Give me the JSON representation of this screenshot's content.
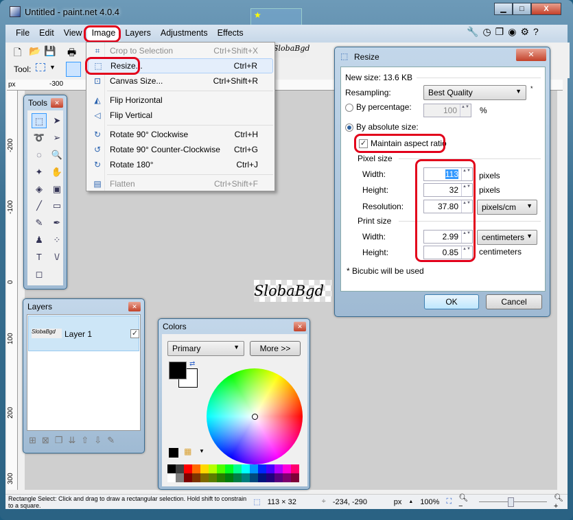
{
  "window": {
    "title": "Untitled - paint.net 4.0.4",
    "minimize": "▁",
    "maximize": "□",
    "close": "X"
  },
  "menubar": [
    "File",
    "Edit",
    "View",
    "Image",
    "Layers",
    "Adjustments",
    "Effects"
  ],
  "toolbar": {
    "tool_label": "Tool:"
  },
  "rulers": {
    "unit": "px",
    "top": [
      "-300"
    ],
    "left": [
      "-200",
      "-100",
      "0",
      "100",
      "200",
      "300"
    ]
  },
  "image_menu": {
    "items": [
      {
        "label": "Crop to Selection",
        "shortcut": "Ctrl+Shift+X",
        "icon": "crop-icon",
        "disabled": true
      },
      {
        "label": "Resize...",
        "shortcut": "Ctrl+R",
        "icon": "resize-icon",
        "highlighted": true
      },
      {
        "label": "Canvas Size...",
        "shortcut": "Ctrl+Shift+R",
        "icon": "canvas-size-icon"
      },
      {
        "label": "Flip Horizontal",
        "shortcut": "",
        "icon": "flip-horizontal-icon"
      },
      {
        "label": "Flip Vertical",
        "shortcut": "",
        "icon": "flip-vertical-icon"
      },
      {
        "label": "Rotate 90° Clockwise",
        "shortcut": "Ctrl+H",
        "icon": "rotate-cw-icon"
      },
      {
        "label": "Rotate 90° Counter-Clockwise",
        "shortcut": "Ctrl+G",
        "icon": "rotate-ccw-icon"
      },
      {
        "label": "Rotate 180°",
        "shortcut": "Ctrl+J",
        "icon": "rotate-180-icon"
      },
      {
        "label": "Flatten",
        "shortcut": "Ctrl+Shift+F",
        "icon": "flatten-icon",
        "disabled": true
      }
    ]
  },
  "tools_panel": {
    "title": "Tools"
  },
  "layers_panel": {
    "title": "Layers",
    "layer_name": "Layer 1",
    "thumb_text": "SlobaBgd"
  },
  "colors_panel": {
    "title": "Colors",
    "mode": "Primary",
    "more_button": "More >>"
  },
  "canvas": {
    "image_text": "SlobaBgd"
  },
  "resize_dialog": {
    "title": "Resize",
    "new_size": "New size: 13.6 KB",
    "resampling_label": "Resampling:",
    "resampling_value": "Best Quality",
    "asterisk": "*",
    "by_percentage_label": "By percentage:",
    "percentage_value": "100",
    "percent_sign": "%",
    "by_absolute_label": "By absolute size:",
    "maintain_label": "Maintain aspect ratio",
    "pixel_size_label": "Pixel size",
    "width_label": "Width:",
    "width_value": "113",
    "height_label": "Height:",
    "height_value": "32",
    "pixels_unit": "pixels",
    "resolution_label": "Resolution:",
    "resolution_value": "37.80",
    "resolution_unit": "pixels/cm",
    "print_size_label": "Print size",
    "print_width_value": "2.99",
    "print_height_value": "0.85",
    "print_unit": "centimeters",
    "note": "* Bicubic will be used",
    "ok": "OK",
    "cancel": "Cancel"
  },
  "statusbar": {
    "hint": "Rectangle Select: Click and drag to draw a rectangular selection. Hold shift to constrain to a square.",
    "selection_size": "113 × 32",
    "cursor": "-234, -290",
    "unit": "px",
    "zoom": "100%"
  },
  "palette": [
    "#000000",
    "#404040",
    "#ff0000",
    "#ff6a00",
    "#ffd800",
    "#b6ff00",
    "#4cff00",
    "#00ff21",
    "#00ff90",
    "#00ffff",
    "#0094ff",
    "#0026ff",
    "#4800ff",
    "#b200ff",
    "#ff00dc",
    "#ff006e",
    "#ffffff",
    "#808080",
    "#7f0000",
    "#7f3300",
    "#7f6a00",
    "#5b7f00",
    "#267f00",
    "#007f0e",
    "#007f46",
    "#007f7f",
    "#004a7f",
    "#00137f",
    "#21007f",
    "#57007f",
    "#7f006e",
    "#7f0037"
  ]
}
